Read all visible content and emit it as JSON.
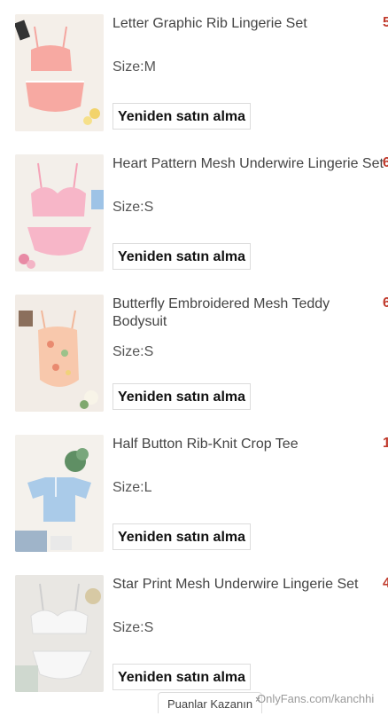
{
  "orders": [
    {
      "title": "Letter Graphic Rib Lingerie Set",
      "size": "Size:M",
      "button": "Yeniden satın alma",
      "price": "5"
    },
    {
      "title": "Heart Pattern Mesh Underwire Lingerie Set",
      "size": "Size:S",
      "button": "Yeniden satın alma",
      "price": "6"
    },
    {
      "title": "Butterfly Embroidered Mesh Teddy Bodysuit",
      "size": "Size:S",
      "button": "Yeniden satın alma",
      "price": "6"
    },
    {
      "title": "Half Button Rib-Knit Crop Tee",
      "size": "Size:L",
      "button": "Yeniden satın alma",
      "price": "1"
    },
    {
      "title": "Star Print Mesh Underwire Lingerie Set",
      "size": "Size:S",
      "button": "Yeniden satın alma",
      "price": "4"
    }
  ],
  "points_tab": "Puanlar Kazanın",
  "points_close": "×",
  "watermark": "OnlyFans.com/kanchhi",
  "colors": {
    "price": "#c0392b",
    "text": "#444444"
  }
}
